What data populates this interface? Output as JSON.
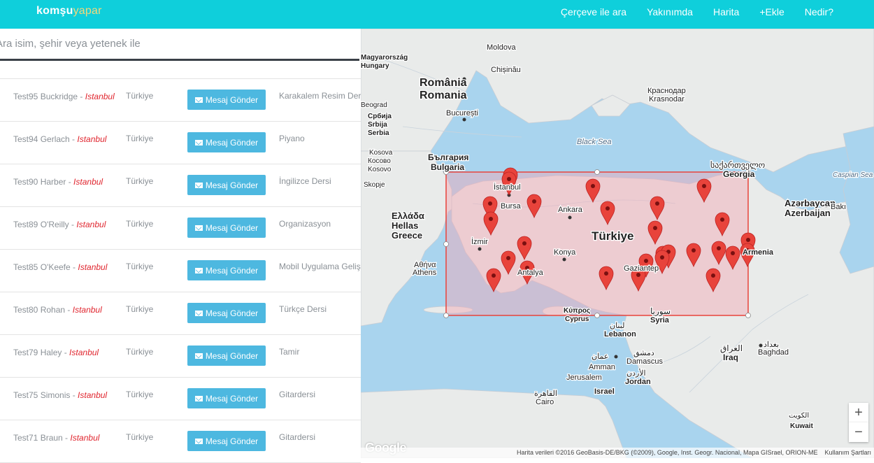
{
  "brand": {
    "part1": "komşu",
    "part2": "yapar"
  },
  "nav": [
    "Çerçeve ile ara",
    "Yakınımda",
    "Harita",
    "+Ekle",
    "Nedir?"
  ],
  "search": {
    "placeholder": "Ara isim, şehir veya yetenek ile",
    "value": ""
  },
  "listings": [
    {
      "name": "Test95 Buckridge",
      "city": "Istanbul",
      "country": "Türkiye",
      "button": "Mesaj Gönder",
      "skill": "Karakalem Resim Dersi"
    },
    {
      "name": "Test94 Gerlach",
      "city": "Istanbul",
      "country": "Türkiye",
      "button": "Mesaj Gönder",
      "skill": "Piyano"
    },
    {
      "name": "Test90 Harber",
      "city": "Istanbul",
      "country": "Türkiye",
      "button": "Mesaj Gönder",
      "skill": "İngilizce Dersi"
    },
    {
      "name": "Test89 O'Reilly",
      "city": "Istanbul",
      "country": "Türkiye",
      "button": "Mesaj Gönder",
      "skill": "Organizasyon"
    },
    {
      "name": "Test85 O'Keefe",
      "city": "Istanbul",
      "country": "Türkiye",
      "button": "Mesaj Gönder",
      "skill": "Mobil Uygulama Geliştirme"
    },
    {
      "name": "Test80 Rohan",
      "city": "Istanbul",
      "country": "Türkiye",
      "button": "Mesaj Gönder",
      "skill": "Türkçe Dersi"
    },
    {
      "name": "Test79 Haley",
      "city": "Istanbul",
      "country": "Türkiye",
      "button": "Mesaj Gönder",
      "skill": "Tamir"
    },
    {
      "name": "Test75 Simonis",
      "city": "Istanbul",
      "country": "Türkiye",
      "button": "Mesaj Gönder",
      "skill": "Gitardersi"
    },
    {
      "name": "Test71 Braun",
      "city": "Istanbul",
      "country": "Türkiye",
      "button": "Mesaj Gönder",
      "skill": "Gitardersi"
    }
  ],
  "map": {
    "labels": {
      "moldova": "Moldova",
      "chisinau": "Chișinău",
      "romania1": "România",
      "romania2": "Romania",
      "bucuresti": "București",
      "krasnodar1": "Краснодар",
      "krasnodar2": "Krasnodar",
      "blacksea": "Black Sea",
      "bulgaria1": "България",
      "bulgaria2": "Bulgaria",
      "georgia1": "საქართველო",
      "georgia2": "Georgia",
      "caspian": "Caspian Sea",
      "istanbul": "İstanbul",
      "bursa": "Bursa",
      "ankara": "Ankara",
      "turkiye": "Türkiye",
      "izmir": "İzmir",
      "konya": "Konya",
      "antalya": "Antalya",
      "gaziantep": "Gaziantep",
      "hellas1": "Ελλάδα",
      "hellas2": "Hellas",
      "hellas3": "Greece",
      "athens1": "Αθήνα",
      "athens2": "Athens",
      "kypros": "Κύπρος",
      "cyprus": "Cyprus",
      "syria1": "سوريا",
      "syria2": "Syria",
      "lebanon1": "لبنان",
      "lebanon2": "Lebanon",
      "damascus1": "دمشق",
      "damascus2": "Damascus",
      "amman1": "عمان",
      "amman2": "Amman",
      "jerusalem": "Jerusalem",
      "jordan1": "الأردن",
      "jordan2": "Jordan",
      "israel": "Israel",
      "cairo1": "القاهرة",
      "cairo2": "Cairo",
      "iraq1": "العراق",
      "iraq2": "Iraq",
      "baghdad1": "بغداد",
      "baghdad2": "Baghdad",
      "kuwait1": "الكويت",
      "kuwait2": "Kuwait",
      "azerbaycan1": "Azərbaycan",
      "azerbaycan2": "Azerbaijan",
      "baki": "Bakı",
      "armenia": "Armenia",
      "kosova1": "Kosova",
      "kosova2": "Косово",
      "kosova3": "Kosovo",
      "srbija1": "Србија",
      "srbija2": "Srbija",
      "srbija3": "Serbia",
      "magyar": "Magyarország",
      "hungary": "Hungary",
      "beograd": "Beograd",
      "skopje": "Skopje"
    },
    "attribution": "Harita verileri ©2016 GeoBasis-DE/BKG (©2009), Google, Inst. Geogr. Nacional, Mapa GISrael, ORION-ME",
    "terms": "Kullanım Şartları",
    "zoom_in": "+",
    "zoom_out": "−",
    "google": "Google",
    "marker_count": 27,
    "colors": {
      "water": "#a9d4ee",
      "land": "#e8eaea",
      "marker": "#e8433b",
      "selection_fill": "#f2a6b3",
      "selection_stroke": "#e8433b"
    }
  }
}
